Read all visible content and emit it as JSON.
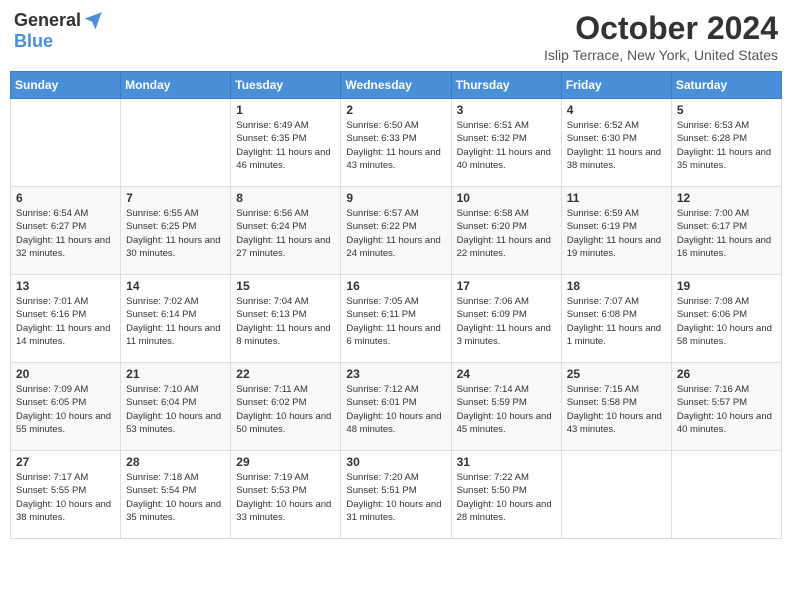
{
  "logo": {
    "general": "General",
    "blue": "Blue"
  },
  "header": {
    "month": "October 2024",
    "location": "Islip Terrace, New York, United States"
  },
  "weekdays": [
    "Sunday",
    "Monday",
    "Tuesday",
    "Wednesday",
    "Thursday",
    "Friday",
    "Saturday"
  ],
  "weeks": [
    [
      {
        "day": "",
        "info": ""
      },
      {
        "day": "",
        "info": ""
      },
      {
        "day": "1",
        "info": "Sunrise: 6:49 AM\nSunset: 6:35 PM\nDaylight: 11 hours and 46 minutes."
      },
      {
        "day": "2",
        "info": "Sunrise: 6:50 AM\nSunset: 6:33 PM\nDaylight: 11 hours and 43 minutes."
      },
      {
        "day": "3",
        "info": "Sunrise: 6:51 AM\nSunset: 6:32 PM\nDaylight: 11 hours and 40 minutes."
      },
      {
        "day": "4",
        "info": "Sunrise: 6:52 AM\nSunset: 6:30 PM\nDaylight: 11 hours and 38 minutes."
      },
      {
        "day": "5",
        "info": "Sunrise: 6:53 AM\nSunset: 6:28 PM\nDaylight: 11 hours and 35 minutes."
      }
    ],
    [
      {
        "day": "6",
        "info": "Sunrise: 6:54 AM\nSunset: 6:27 PM\nDaylight: 11 hours and 32 minutes."
      },
      {
        "day": "7",
        "info": "Sunrise: 6:55 AM\nSunset: 6:25 PM\nDaylight: 11 hours and 30 minutes."
      },
      {
        "day": "8",
        "info": "Sunrise: 6:56 AM\nSunset: 6:24 PM\nDaylight: 11 hours and 27 minutes."
      },
      {
        "day": "9",
        "info": "Sunrise: 6:57 AM\nSunset: 6:22 PM\nDaylight: 11 hours and 24 minutes."
      },
      {
        "day": "10",
        "info": "Sunrise: 6:58 AM\nSunset: 6:20 PM\nDaylight: 11 hours and 22 minutes."
      },
      {
        "day": "11",
        "info": "Sunrise: 6:59 AM\nSunset: 6:19 PM\nDaylight: 11 hours and 19 minutes."
      },
      {
        "day": "12",
        "info": "Sunrise: 7:00 AM\nSunset: 6:17 PM\nDaylight: 11 hours and 16 minutes."
      }
    ],
    [
      {
        "day": "13",
        "info": "Sunrise: 7:01 AM\nSunset: 6:16 PM\nDaylight: 11 hours and 14 minutes."
      },
      {
        "day": "14",
        "info": "Sunrise: 7:02 AM\nSunset: 6:14 PM\nDaylight: 11 hours and 11 minutes."
      },
      {
        "day": "15",
        "info": "Sunrise: 7:04 AM\nSunset: 6:13 PM\nDaylight: 11 hours and 8 minutes."
      },
      {
        "day": "16",
        "info": "Sunrise: 7:05 AM\nSunset: 6:11 PM\nDaylight: 11 hours and 6 minutes."
      },
      {
        "day": "17",
        "info": "Sunrise: 7:06 AM\nSunset: 6:09 PM\nDaylight: 11 hours and 3 minutes."
      },
      {
        "day": "18",
        "info": "Sunrise: 7:07 AM\nSunset: 6:08 PM\nDaylight: 11 hours and 1 minute."
      },
      {
        "day": "19",
        "info": "Sunrise: 7:08 AM\nSunset: 6:06 PM\nDaylight: 10 hours and 58 minutes."
      }
    ],
    [
      {
        "day": "20",
        "info": "Sunrise: 7:09 AM\nSunset: 6:05 PM\nDaylight: 10 hours and 55 minutes."
      },
      {
        "day": "21",
        "info": "Sunrise: 7:10 AM\nSunset: 6:04 PM\nDaylight: 10 hours and 53 minutes."
      },
      {
        "day": "22",
        "info": "Sunrise: 7:11 AM\nSunset: 6:02 PM\nDaylight: 10 hours and 50 minutes."
      },
      {
        "day": "23",
        "info": "Sunrise: 7:12 AM\nSunset: 6:01 PM\nDaylight: 10 hours and 48 minutes."
      },
      {
        "day": "24",
        "info": "Sunrise: 7:14 AM\nSunset: 5:59 PM\nDaylight: 10 hours and 45 minutes."
      },
      {
        "day": "25",
        "info": "Sunrise: 7:15 AM\nSunset: 5:58 PM\nDaylight: 10 hours and 43 minutes."
      },
      {
        "day": "26",
        "info": "Sunrise: 7:16 AM\nSunset: 5:57 PM\nDaylight: 10 hours and 40 minutes."
      }
    ],
    [
      {
        "day": "27",
        "info": "Sunrise: 7:17 AM\nSunset: 5:55 PM\nDaylight: 10 hours and 38 minutes."
      },
      {
        "day": "28",
        "info": "Sunrise: 7:18 AM\nSunset: 5:54 PM\nDaylight: 10 hours and 35 minutes."
      },
      {
        "day": "29",
        "info": "Sunrise: 7:19 AM\nSunset: 5:53 PM\nDaylight: 10 hours and 33 minutes."
      },
      {
        "day": "30",
        "info": "Sunrise: 7:20 AM\nSunset: 5:51 PM\nDaylight: 10 hours and 31 minutes."
      },
      {
        "day": "31",
        "info": "Sunrise: 7:22 AM\nSunset: 5:50 PM\nDaylight: 10 hours and 28 minutes."
      },
      {
        "day": "",
        "info": ""
      },
      {
        "day": "",
        "info": ""
      }
    ]
  ]
}
